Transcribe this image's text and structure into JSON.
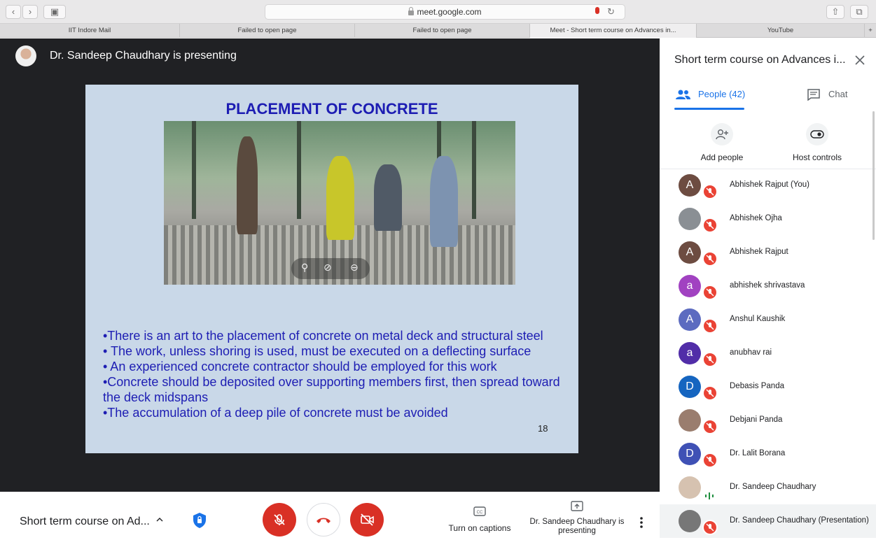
{
  "browser": {
    "url": "meet.google.com",
    "tabs": [
      "IIT Indore Mail",
      "Failed to open page",
      "Failed to open page",
      "Meet - Short term course on Advances in...",
      "YouTube"
    ],
    "new_tab_label": "+"
  },
  "stage": {
    "presenter_text": "Dr. Sandeep Chaudhary is presenting",
    "slide": {
      "title": "PLACEMENT OF CONCRETE",
      "bullets": [
        "•There is an art to the placement of concrete on metal deck and structural steel",
        "• The work, unless shoring is used, must be executed on a deflecting surface",
        "• An experienced concrete contractor should be employed for this work",
        "•Concrete should be deposited over supporting members first, then spread toward the deck midspans",
        "•The accumulation of a deep pile of concrete must be avoided"
      ],
      "page_number": "18"
    }
  },
  "bottom_bar": {
    "meeting_title": "Short term course on Ad...",
    "captions_label": "Turn on captions",
    "presenting_label": "Dr. Sandeep Chaudhary is presenting"
  },
  "panel": {
    "title": "Short term course on Advances i...",
    "people_tab": "People (42)",
    "chat_tab": "Chat",
    "add_people": "Add people",
    "host_controls": "Host controls",
    "participants": [
      {
        "name": "Abhishek Rajput (You)",
        "initial": "A",
        "color": "#6d4c41",
        "muted": true
      },
      {
        "name": "Abhishek Ojha",
        "initial": "",
        "color": "#8a8f94",
        "muted": true
      },
      {
        "name": "Abhishek Rajput",
        "initial": "A",
        "color": "#6d4c41",
        "muted": true
      },
      {
        "name": "abhishek shrivastava",
        "initial": "a",
        "color": "#a142c1",
        "muted": true
      },
      {
        "name": "Anshul Kaushik",
        "initial": "A",
        "color": "#5c6bc0",
        "muted": true
      },
      {
        "name": "anubhav rai",
        "initial": "a",
        "color": "#512da8",
        "muted": true
      },
      {
        "name": "Debasis Panda",
        "initial": "D",
        "color": "#1565c0",
        "muted": true
      },
      {
        "name": "Debjani Panda",
        "initial": "",
        "color": "#9a7d6e",
        "muted": true
      },
      {
        "name": "Dr. Lalit Borana",
        "initial": "D",
        "color": "#3f51b5",
        "muted": true
      },
      {
        "name": "Dr. Sandeep Chaudhary",
        "initial": "",
        "color": "#d6c2b0",
        "muted": false
      },
      {
        "name": "Dr. Sandeep Chaudhary (Presentation)",
        "initial": "",
        "color": "#777",
        "muted": true
      }
    ]
  },
  "colors": {
    "stage_bg": "#202124",
    "red": "#d93025",
    "blue": "#1a73e8",
    "slide_text": "#1d1db3"
  }
}
